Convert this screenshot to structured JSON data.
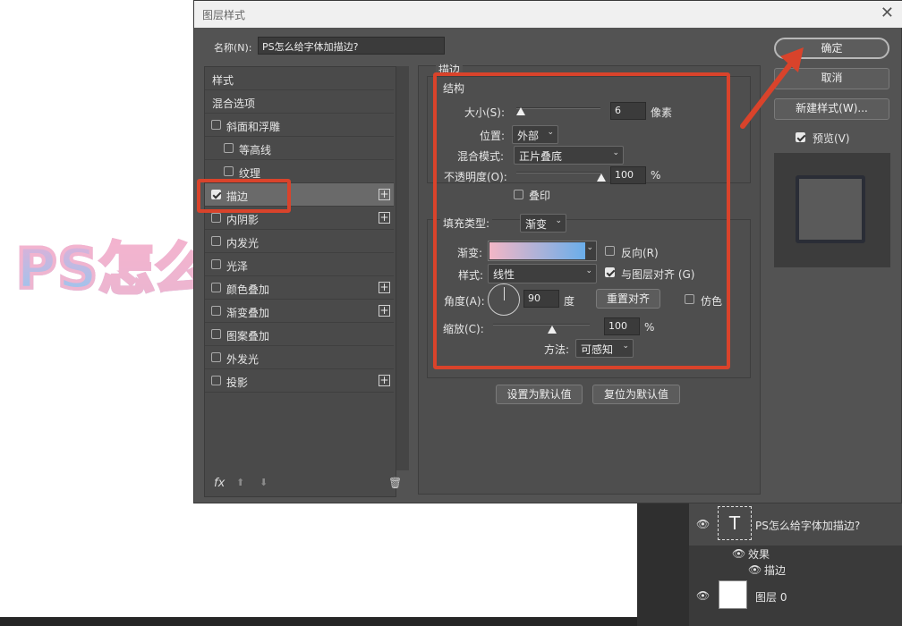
{
  "canvas": {
    "text": "PS怎么"
  },
  "dialog": {
    "title": "图层样式",
    "name_label": "名称(N):",
    "name_value": "PS怎么给字体加描边?"
  },
  "style_list": {
    "header": "样式",
    "blend_options": "混合选项",
    "items": [
      {
        "label": "斜面和浮雕",
        "checked": false,
        "plus": false
      },
      {
        "label": "等高线",
        "checked": false,
        "plus": false
      },
      {
        "label": "纹理",
        "checked": false,
        "plus": false
      },
      {
        "label": "描边",
        "checked": true,
        "plus": true
      },
      {
        "label": "内阴影",
        "checked": false,
        "plus": true
      },
      {
        "label": "内发光",
        "checked": false,
        "plus": false
      },
      {
        "label": "光泽",
        "checked": false,
        "plus": false
      },
      {
        "label": "颜色叠加",
        "checked": false,
        "plus": true
      },
      {
        "label": "渐变叠加",
        "checked": false,
        "plus": true
      },
      {
        "label": "图案叠加",
        "checked": false,
        "plus": false
      },
      {
        "label": "外发光",
        "checked": false,
        "plus": false
      },
      {
        "label": "投影",
        "checked": false,
        "plus": true
      }
    ],
    "fx": "fx"
  },
  "stroke": {
    "section_title": "描边",
    "structure_title": "结构",
    "size_label": "大小(S):",
    "size_value": "6",
    "size_unit": "像素",
    "position_label": "位置:",
    "position_value": "外部",
    "blend_label": "混合模式:",
    "blend_value": "正片叠底",
    "opacity_label": "不透明度(O):",
    "opacity_value": "100",
    "opacity_unit": "%",
    "overprint_label": "叠印",
    "fill_type_label": "填充类型:",
    "fill_type_value": "渐变",
    "gradient_label": "渐变:",
    "reverse_label": "反向(R)",
    "style_label": "样式:",
    "style_value": "线性",
    "align_label": "与图层对齐 (G)",
    "angle_label": "角度(A):",
    "angle_value": "90",
    "angle_unit": "度",
    "reset_align": "重置对齐",
    "dither_label": "仿色",
    "scale_label": "缩放(C):",
    "scale_value": "100",
    "scale_unit": "%",
    "method_label": "方法:",
    "method_value": "可感知",
    "size_level": 0.06,
    "opacity_level": 1.0,
    "scale_level": 0.5
  },
  "buttons": {
    "ok": "确定",
    "cancel": "取消",
    "new_style": "新建样式(W)...",
    "preview": "预览(V)",
    "set_default": "设置为默认值",
    "reset_default": "复位为默认值"
  },
  "layers": {
    "text_layer": "PS怎么给字体加描边?",
    "effects": "效果",
    "stroke_effect": "描边",
    "bg_layer": "图层 0"
  },
  "colors": {
    "annotation": "#d9432b",
    "gradient_start": "#f3b6c6",
    "gradient_end": "#6aaeea"
  }
}
